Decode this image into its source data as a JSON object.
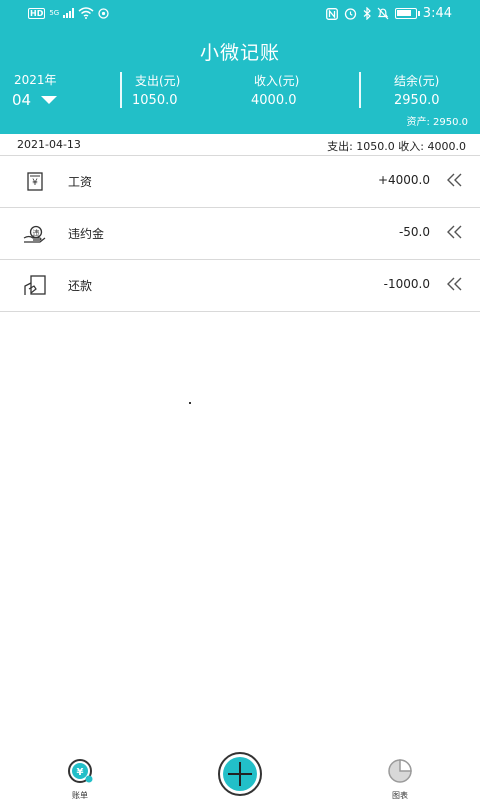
{
  "status_bar": {
    "hd": "HD",
    "signal": "5G",
    "time": "3:44"
  },
  "header": {
    "title": "小微记账",
    "year": "2021年",
    "month": "04",
    "expense_label": "支出(元)",
    "expense_value": "1050.0",
    "income_label": "收入(元)",
    "income_value": "4000.0",
    "balance_label": "结余(元)",
    "balance_value": "2950.0",
    "asset_text": "资产:  2950.0"
  },
  "date_row": {
    "date": "2021-04-13",
    "summary": "支出: 1050.0 收入: 4000.0"
  },
  "records": [
    {
      "name": "工资",
      "amount": "+4000.0",
      "icon": "salary-icon"
    },
    {
      "name": "违约金",
      "amount": "-50.0",
      "icon": "penalty-icon"
    },
    {
      "name": "还款",
      "amount": "-1000.0",
      "icon": "repayment-icon"
    }
  ],
  "nav": {
    "bills_label": "账单",
    "chart_label": "图表",
    "add_icon": "plus-icon"
  },
  "colors": {
    "accent": "#22bfc8",
    "text": "#222222",
    "divider": "#d9d9d9"
  }
}
